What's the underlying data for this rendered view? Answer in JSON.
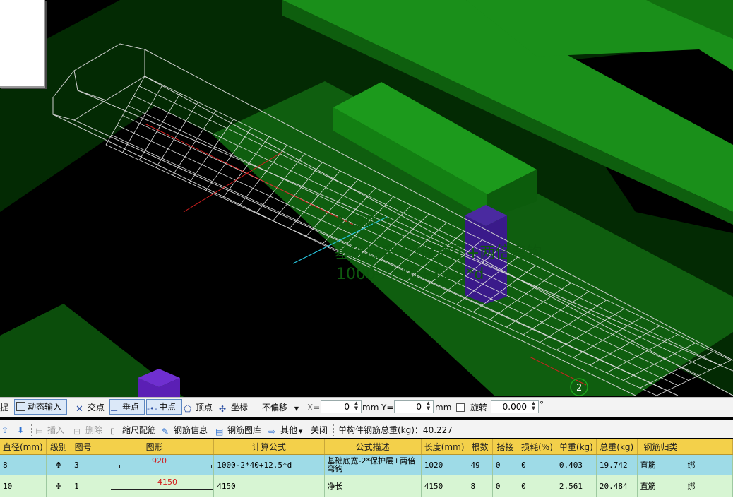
{
  "viewport": {
    "annotation": {
      "length": "1020",
      "description": "基础底宽-2*保护层+两倍弯钩",
      "formula": "1000-2*40+12.5*d"
    },
    "axis_marker": "2"
  },
  "toolbar1": {
    "partial_left": "捉",
    "dynamic_input": "动态输入",
    "intersection": "交点",
    "perpendicular": "垂点",
    "midpoint": "中点",
    "vertex": "顶点",
    "coordinate": "坐标",
    "offset_mode": "不偏移",
    "x_label": "X=",
    "x_value": "0",
    "x_unit": "mm",
    "y_label": "Y=",
    "y_value": "0",
    "y_unit": "mm",
    "rotate_label": "旋转",
    "rotate_value": "0.000",
    "degree": "°"
  },
  "toolbar2": {
    "insert": "插入",
    "delete": "删除",
    "scale_rebar": "缩尺配筋",
    "rebar_info": "钢筋信息",
    "rebar_library": "钢筋图库",
    "other": "其他",
    "close": "关闭",
    "total_weight": "单构件钢筋总重(kg)：40.227"
  },
  "grid": {
    "headers": [
      "直径(mm)",
      "级别",
      "图号",
      "图形",
      "计算公式",
      "公式描述",
      "长度(mm)",
      "根数",
      "搭接",
      "损耗(%)",
      "单重(kg)",
      "总重(kg)",
      "钢筋归类",
      ""
    ],
    "rows": [
      {
        "diameter": "8",
        "grade": "Φ",
        "figure_no": "3",
        "shape_label": "920",
        "formula": "1000-2*40+12.5*d",
        "description": "基础底宽-2*保护层+两倍弯钩",
        "length": "1020",
        "count": "49",
        "lap": "0",
        "loss": "0",
        "unit_weight": "0.403",
        "total_weight": "19.742",
        "category": "直筋",
        "extra": "绑"
      },
      {
        "diameter": "10",
        "grade": "Φ",
        "figure_no": "1",
        "shape_label": "4150",
        "formula": "4150",
        "description": "净长",
        "length": "4150",
        "count": "8",
        "lap": "0",
        "loss": "0",
        "unit_weight": "2.561",
        "total_weight": "20.484",
        "category": "直筋",
        "extra": "绑"
      }
    ]
  },
  "colors": {
    "beam_green": "#1b8a1b",
    "column_purple": "#5b1fb5",
    "grid_header": "#f3d04a",
    "row_selected": "#9edbe7",
    "row_normal": "#d7f5d3"
  }
}
